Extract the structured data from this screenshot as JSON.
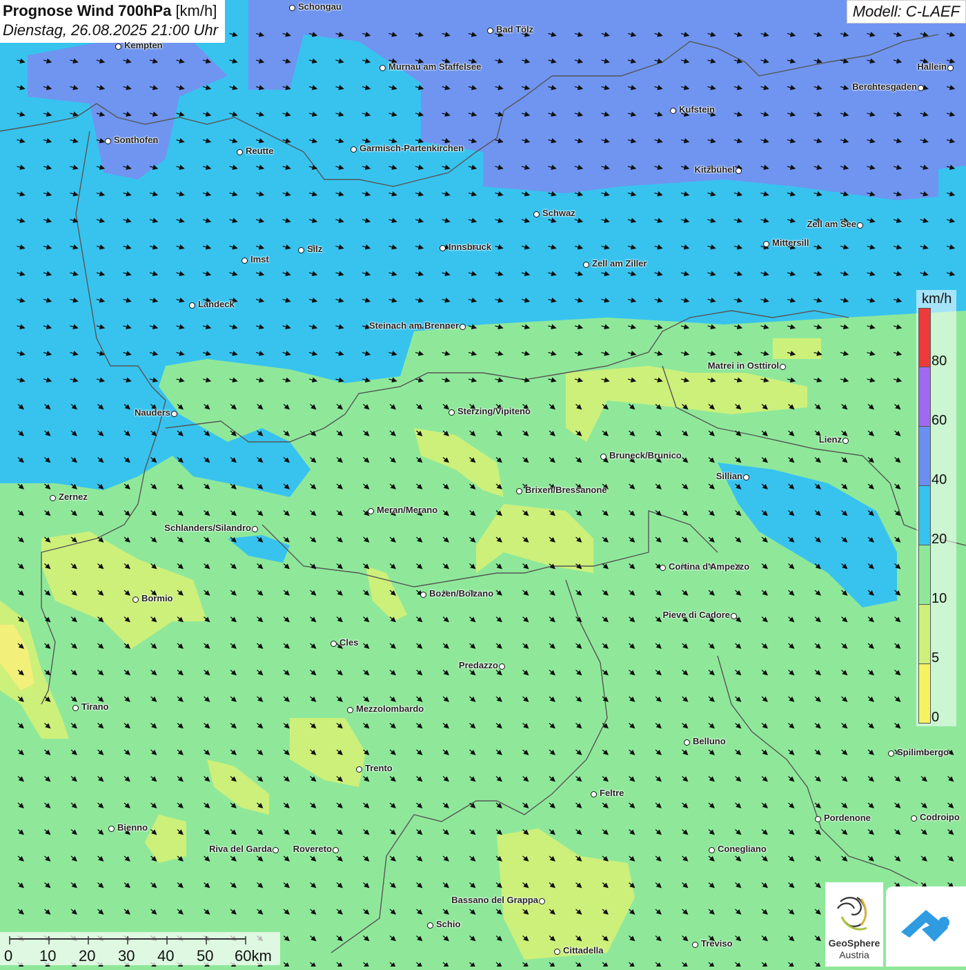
{
  "header": {
    "title_bold": "Prognose Wind 700hPa",
    "title_unit": "[km/h]",
    "subtitle": "Dienstag, 26.08.2025 21:00 Uhr",
    "model": "Modell: C-LAEF"
  },
  "legend": {
    "unit": "km/h",
    "classes": [
      {
        "label": "80",
        "color": "#ee3a3a"
      },
      {
        "label": "60",
        "color": "#a06af0"
      },
      {
        "label": "40",
        "color": "#6a8ff0"
      },
      {
        "label": "20",
        "color": "#35c3ef"
      },
      {
        "label": "10",
        "color": "#8fe89a"
      },
      {
        "label": "5",
        "color": "#cdf07a"
      },
      {
        "label": "0",
        "color": "#f7f25f"
      }
    ]
  },
  "cities": [
    {
      "name": "Schongau"
    },
    {
      "name": "Bad Tölz"
    },
    {
      "name": "Kempten"
    },
    {
      "name": "Murnau am Staffelsee"
    },
    {
      "name": "Hallein"
    },
    {
      "name": "Berchtesgaden"
    },
    {
      "name": "Kufstein"
    },
    {
      "name": "Sonthofen"
    },
    {
      "name": "Reutte"
    },
    {
      "name": "Garmisch-Partenkirchen"
    },
    {
      "name": "Kitzbühel"
    },
    {
      "name": "Schwaz"
    },
    {
      "name": "Zell am See"
    },
    {
      "name": "Mittersill"
    },
    {
      "name": "Innsbruck"
    },
    {
      "name": "Silz"
    },
    {
      "name": "Imst"
    },
    {
      "name": "Zell am Ziller"
    },
    {
      "name": "Landeck"
    },
    {
      "name": "Steinach am Brenner"
    },
    {
      "name": "Matrei in Osttirol"
    },
    {
      "name": "Nauders"
    },
    {
      "name": "Sterzing/Vipiteno"
    },
    {
      "name": "Lienz"
    },
    {
      "name": "Bruneck/Brunico"
    },
    {
      "name": "Sillian"
    },
    {
      "name": "Zernez"
    },
    {
      "name": "Brixen/Bressanone"
    },
    {
      "name": "Meran/Merano"
    },
    {
      "name": "Schlanders/Silandro"
    },
    {
      "name": "Cortina d'Ampezzo"
    },
    {
      "name": "Bozen/Bolzano"
    },
    {
      "name": "Bormio"
    },
    {
      "name": "Pieve di Cadore"
    },
    {
      "name": "Cles"
    },
    {
      "name": "Predazzo"
    },
    {
      "name": "Tirano"
    },
    {
      "name": "Mezzolombardo"
    },
    {
      "name": "Belluno"
    },
    {
      "name": "Spilimbergo"
    },
    {
      "name": "Trento"
    },
    {
      "name": "Feltre"
    },
    {
      "name": "Pordenone"
    },
    {
      "name": "Codroipo"
    },
    {
      "name": "Bienno"
    },
    {
      "name": "Riva del Garda"
    },
    {
      "name": "Rovereto"
    },
    {
      "name": "Conegliano"
    },
    {
      "name": "Bassano del Grappa"
    },
    {
      "name": "Schio"
    },
    {
      "name": "Treviso"
    },
    {
      "name": "Cittadella"
    }
  ],
  "scale_bar": {
    "labels": [
      "0",
      "10",
      "20",
      "30",
      "40",
      "50",
      "60km"
    ]
  },
  "logo": {
    "name": "GeoSphere",
    "subname": "Austria"
  }
}
